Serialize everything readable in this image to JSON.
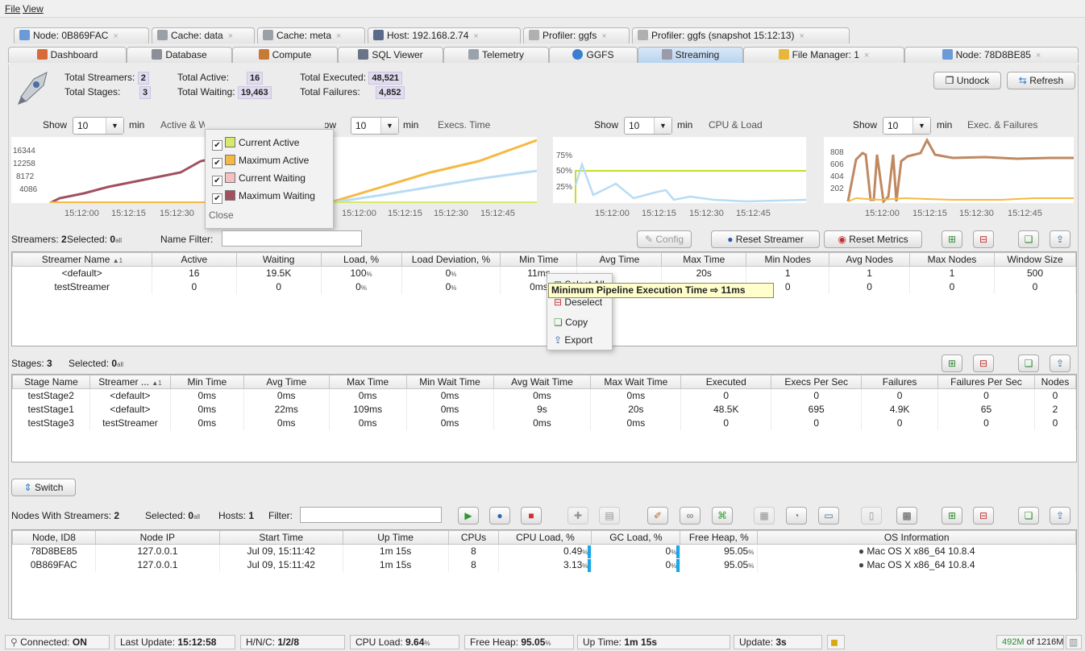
{
  "menu": {
    "file": "File",
    "view": "View"
  },
  "tabs_top": [
    {
      "label": "Node: 0B869FAC"
    },
    {
      "label": "Cache: data"
    },
    {
      "label": "Cache: meta"
    },
    {
      "label": "Host: 192.168.2.74"
    },
    {
      "label": "Profiler: ggfs"
    },
    {
      "label": "Profiler: ggfs (snapshot 15:12:13)"
    }
  ],
  "tabs_main": [
    {
      "label": "Dashboard"
    },
    {
      "label": "Database"
    },
    {
      "label": "Compute"
    },
    {
      "label": "SQL Viewer"
    },
    {
      "label": "Telemetry"
    },
    {
      "label": "GGFS"
    },
    {
      "label": "Streaming"
    },
    {
      "label": "File Manager: 1"
    },
    {
      "label": "Node: 78D8BE85"
    }
  ],
  "close_mark": "×",
  "summary": {
    "total_streamers_label": "Total Streamers:",
    "total_streamers": "2",
    "total_stages_label": "Total Stages:",
    "total_stages": "3",
    "total_active_label": "Total Active:",
    "total_active": "16",
    "total_waiting_label": "Total Waiting:",
    "total_waiting": "19,463",
    "total_executed_label": "Total Executed:",
    "total_executed": "48,521",
    "total_failures_label": "Total Failures:",
    "total_failures": "4,852"
  },
  "toolbar": {
    "undock": "Undock",
    "refresh": "Refresh"
  },
  "charts": [
    {
      "show": "Show",
      "value": "10",
      "unit": "min",
      "title": "Active & Waiting",
      "yticks": [
        "16344",
        "12258",
        "8172",
        "4086"
      ],
      "xticks": [
        "15:12:00",
        "15:12:15",
        "15:12:30"
      ]
    },
    {
      "show": "Show",
      "value": "10",
      "unit": "min",
      "title": "Execs. Time",
      "yticks": [],
      "xticks": [
        "15:12:00",
        "15:12:15",
        "15:12:30",
        "15:12:45"
      ]
    },
    {
      "show": "Show",
      "value": "10",
      "unit": "min",
      "title": "CPU & Load",
      "yticks": [
        "75%",
        "50%",
        "25%"
      ],
      "xticks": [
        "15:12:00",
        "15:12:15",
        "15:12:30",
        "15:12:45"
      ]
    },
    {
      "show": "Show",
      "value": "10",
      "unit": "min",
      "title": "Exec. & Failures",
      "yticks": [
        "808",
        "606",
        "404",
        "202"
      ],
      "xticks": [
        "15:12:00",
        "15:12:15",
        "15:12:30",
        "15:12:45"
      ]
    }
  ],
  "legend_popup": {
    "items": [
      {
        "label": "Current Active",
        "color": "#d8e86a"
      },
      {
        "label": "Maximum Active",
        "color": "#f5b942"
      },
      {
        "label": "Current Waiting",
        "color": "#f6c0c0"
      },
      {
        "label": "Maximum Waiting",
        "color": "#a0505e"
      }
    ],
    "close": "Close"
  },
  "streamers": {
    "count_label": "Streamers:",
    "count": "2",
    "selected_label": "Selected:",
    "selected": "0",
    "all": "all",
    "filter_label": "Name Filter:",
    "config": "Config",
    "reset_streamer": "Reset Streamer",
    "reset_metrics": "Reset Metrics",
    "columns": [
      "Streamer Name",
      "Active",
      "Waiting",
      "Load, %",
      "Load Deviation, %",
      "Min Time",
      "Avg Time",
      "Max Time",
      "Min Nodes",
      "Avg Nodes",
      "Max Nodes",
      "Window Size"
    ],
    "sort_mark": "▲1",
    "rows": [
      [
        "<default>",
        "16",
        "19.5K",
        "100",
        "0",
        "11ms",
        "",
        "20s",
        "1",
        "1",
        "1",
        "500"
      ],
      [
        "testStreamer",
        "0",
        "0",
        "0",
        "0",
        "0ms",
        "",
        "",
        "0",
        "0",
        "0",
        "0"
      ]
    ],
    "pct": "%"
  },
  "context_menu": {
    "select_all": "Select All",
    "deselect": "Deselect",
    "copy": "Copy",
    "export": "Export"
  },
  "tooltip": {
    "text": "Minimum Pipeline Execution Time ⇨ 11ms"
  },
  "stages": {
    "count_label": "Stages:",
    "count": "3",
    "selected_label": "Selected:",
    "selected": "0",
    "all": "all",
    "columns": [
      "Stage Name",
      "Streamer ...",
      "Min Time",
      "Avg Time",
      "Max Time",
      "Min Wait Time",
      "Avg Wait Time",
      "Max Wait Time",
      "Executed",
      "Execs Per Sec",
      "Failures",
      "Failures Per Sec",
      "Nodes"
    ],
    "sort_mark": "▲1",
    "rows": [
      [
        "testStage2",
        "<default>",
        "0ms",
        "0ms",
        "0ms",
        "0ms",
        "0ms",
        "0ms",
        "0",
        "0",
        "0",
        "0",
        "0"
      ],
      [
        "testStage1",
        "<default>",
        "0ms",
        "22ms",
        "109ms",
        "0ms",
        "9s",
        "20s",
        "48.5K",
        "695",
        "4.9K",
        "65",
        "2"
      ],
      [
        "testStage3",
        "testStreamer",
        "0ms",
        "0ms",
        "0ms",
        "0ms",
        "0ms",
        "0ms",
        "0",
        "0",
        "0",
        "0",
        "0"
      ]
    ]
  },
  "switch": "Switch",
  "nodes": {
    "count_label": "Nodes With Streamers:",
    "count": "2",
    "selected_label": "Selected:",
    "selected": "0",
    "all": "all",
    "hosts_label": "Hosts:",
    "hosts": "1",
    "filter_label": "Filter:",
    "columns": [
      "Node, ID8",
      "Node IP",
      "Start Time",
      "Up Time",
      "CPUs",
      "CPU Load, %",
      "GC Load, %",
      "Free Heap, %",
      "OS Information"
    ],
    "rows": [
      {
        "id": "78D8BE85",
        "ip": "127.0.0.1",
        "start": "Jul 09, 15:11:42",
        "up": "1m 15s",
        "cpus": "8",
        "cpu": "0.49",
        "gc": "0",
        "heap": "95.05",
        "os": "Mac OS X x86_64 10.8.4"
      },
      {
        "id": "0B869FAC",
        "ip": "127.0.0.1",
        "start": "Jul 09, 15:11:42",
        "up": "1m 15s",
        "cpus": "8",
        "cpu": "3.13",
        "gc": "0",
        "heap": "95.05",
        "os": "Mac OS X x86_64 10.8.4"
      }
    ],
    "pct": "%"
  },
  "status": {
    "connected_label": "Connected:",
    "connected": "ON",
    "last_update_label": "Last Update:",
    "last_update": "15:12:58",
    "hnc_label": "H/N/C:",
    "hnc": "1/2/8",
    "cpu_label": "CPU Load:",
    "cpu": "9.64",
    "pct": "%",
    "heap_label": "Free Heap:",
    "heap": "95.05",
    "uptime_label": "Up Time:",
    "uptime": "1m 15s",
    "update_label": "Update:",
    "update": "3s",
    "mem_used": "492M",
    "mem_of": "of 1216M"
  },
  "colors": {
    "accent": "#1aa6e8",
    "purple_value": "#e2dcf0",
    "selected_tab": "#b8d4f0"
  }
}
